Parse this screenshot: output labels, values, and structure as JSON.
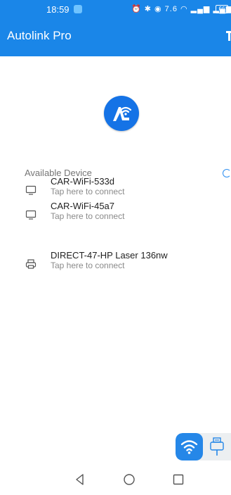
{
  "status_bar": {
    "time": "18:59",
    "icons_text": "⏰ ✱ ◉ 7.6 ◠ ▂▄▆ ▂▄▆",
    "battery": "66"
  },
  "app_bar": {
    "title": "Autolink Pro",
    "menu_icon": "overflow-menu-icon"
  },
  "logo": {
    "icon": "autolink-logo-icon",
    "color": "#1573e6"
  },
  "devices_section": {
    "title": "Available Device",
    "spinner_icon": "refresh-spinner-icon",
    "devices": [
      {
        "name": "CAR-WiFi-533d",
        "status": "Tap here to connect",
        "icon": "monitor-icon"
      },
      {
        "name": "CAR-WiFi-45a7",
        "status": "Tap here to connect",
        "icon": "monitor-icon"
      },
      {
        "name": "DIRECT-47-HP Laser 136nw",
        "status": "Tap here to connect",
        "icon": "printer-icon"
      }
    ]
  },
  "connection_toggle": {
    "selected": "wifi",
    "options": [
      "wifi",
      "usb"
    ],
    "accent": "#2587e8"
  },
  "nav_bar": {
    "buttons": [
      "back-icon",
      "home-icon",
      "recents-icon"
    ]
  },
  "colors": {
    "primary": "#1a86e8",
    "text_secondary": "#8a8a8a"
  }
}
